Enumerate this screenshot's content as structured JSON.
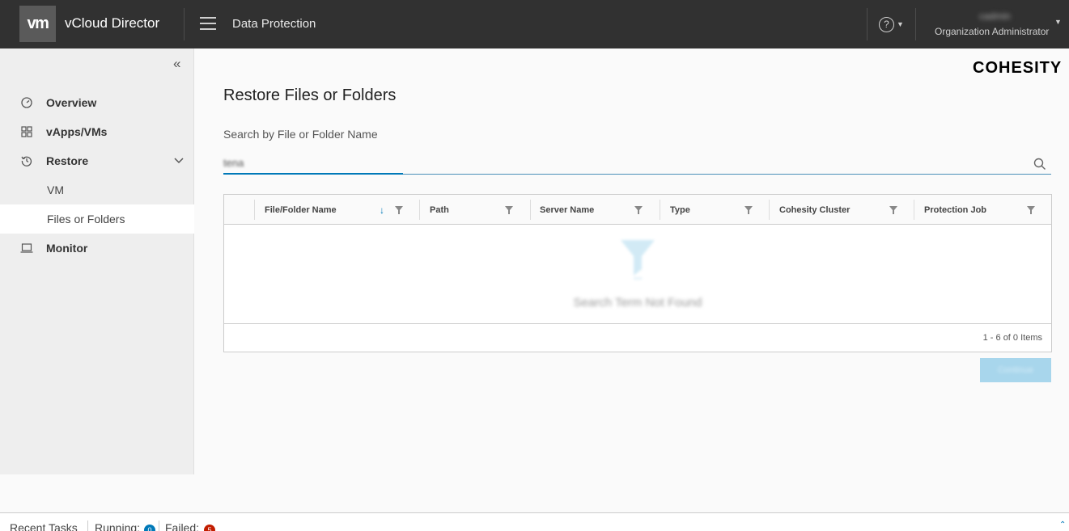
{
  "header": {
    "logo": "vm",
    "app_title": "vCloud Director",
    "section_title": "Data Protection",
    "help_symbol": "?",
    "user_name": "cadmin",
    "user_role": "Organization Administrator"
  },
  "sidebar": {
    "items": [
      {
        "label": "Overview",
        "icon": "gauge-icon"
      },
      {
        "label": "vApps/VMs",
        "icon": "grid-icon"
      },
      {
        "label": "Restore",
        "icon": "history-icon"
      },
      {
        "label": "VM",
        "icon": ""
      },
      {
        "label": "Files or Folders",
        "icon": ""
      },
      {
        "label": "Monitor",
        "icon": "laptop-icon"
      }
    ]
  },
  "main": {
    "brand": "COHESITY",
    "page_title": "Restore Files or Folders",
    "search_label": "Search by File or Folder Name",
    "search_value": "tena",
    "grid": {
      "columns": [
        "File/Folder Name",
        "Path",
        "Server Name",
        "Type",
        "Cohesity Cluster",
        "Protection Job"
      ],
      "empty_text": "Search Term Not Found",
      "footer": "1 - 6 of 0 Items"
    },
    "restore_button": "Continue"
  },
  "bottom": {
    "recent_tasks": "Recent Tasks",
    "running_label": "Running:",
    "running_count": "0",
    "failed_label": "Failed:",
    "failed_count": "5"
  },
  "colors": {
    "header_bg": "#313131",
    "accent": "#0079b8",
    "running_badge": "#0079b8",
    "failed_badge": "#c21d00"
  }
}
